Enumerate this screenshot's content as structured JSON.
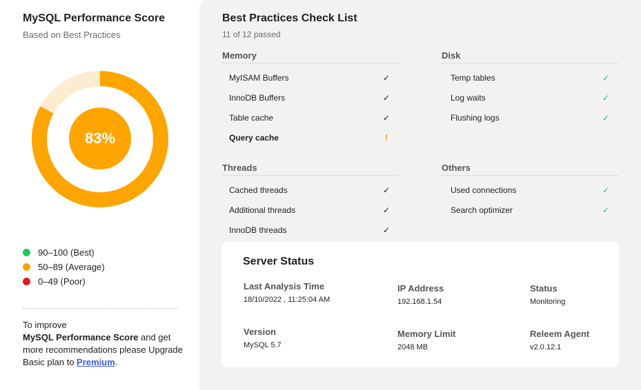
{
  "score_panel": {
    "title": "MySQL Performance Score",
    "subtitle": "Based on Best Practices",
    "score_text": "83%",
    "score_value": 83,
    "ring_color": "#ffa500",
    "ring_track_color": "#fdeccf",
    "legend": [
      {
        "label": "90–100 (Best)",
        "color": "#22c55e"
      },
      {
        "label": "50–89 (Average)",
        "color": "#ffa500"
      },
      {
        "label": "0–49 (Poor)",
        "color": "#e11d1d"
      }
    ],
    "improve": {
      "line1": "To improve",
      "bold_text": "MySQL Performance Score",
      "line2": " and get more recommendations please Upgrade Basic plan to ",
      "link_text": "Premium",
      "tail": "."
    }
  },
  "checklist": {
    "title": "Best Practices Check List",
    "subtitle": "11 of 12 passed",
    "groups": [
      {
        "title": "Memory",
        "items": [
          {
            "label": "MyISAM Buffers",
            "mark": "✓",
            "status": "ok-dark"
          },
          {
            "label": "InnoDB Buffers",
            "mark": "✓",
            "status": "ok-dark"
          },
          {
            "label": "Table cache",
            "mark": "✓",
            "status": "ok-dark"
          },
          {
            "label": "Query cache",
            "mark": "!",
            "status": "warn"
          }
        ]
      },
      {
        "title": "Disk",
        "items": [
          {
            "label": "Temp tables",
            "mark": "✓",
            "status": "ok-green"
          },
          {
            "label": "Log waits",
            "mark": "✓",
            "status": "ok-green"
          },
          {
            "label": "Flushing logs",
            "mark": "✓",
            "status": "ok-green"
          }
        ]
      },
      {
        "title": "Threads",
        "items": [
          {
            "label": "Cached threads",
            "mark": "✓",
            "status": "ok-dark"
          },
          {
            "label": "Additional threads",
            "mark": "✓",
            "status": "ok-dark"
          },
          {
            "label": "InnoDB threads",
            "mark": "✓",
            "status": "ok-dark"
          }
        ]
      },
      {
        "title": "Others",
        "items": [
          {
            "label": "Used connections",
            "mark": "✓",
            "status": "ok-green"
          },
          {
            "label": "Search optimizer",
            "mark": "✓",
            "status": "ok-green"
          }
        ]
      }
    ]
  },
  "server_status": {
    "title": "Server Status",
    "fields": {
      "last_analysis": {
        "label": "Last Analysis Time",
        "value": "18/10/2022 , 11:25:04 AM"
      },
      "ip": {
        "label": "IP Address",
        "value": "192.168.1.54"
      },
      "status": {
        "label": "Status",
        "value": "Monitoring"
      },
      "version": {
        "label": "Version",
        "value": "MySQL 5.7"
      },
      "memory": {
        "label": "Memory Limit",
        "value": "2048 MB"
      },
      "agent": {
        "label": "Releem Agent",
        "value": "v2.0.12.1"
      }
    }
  }
}
